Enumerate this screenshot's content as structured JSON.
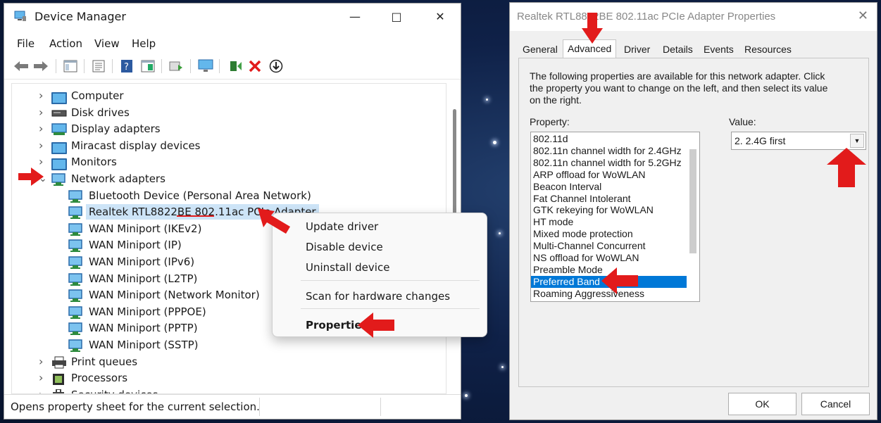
{
  "device_manager": {
    "title": "Device Manager",
    "menu": [
      "File",
      "Action",
      "View",
      "Help"
    ],
    "tree": [
      {
        "label": "Computer",
        "level": 0,
        "icon": "monitor-icon"
      },
      {
        "label": "Disk drives",
        "level": 0,
        "icon": "disk-drive-icon"
      },
      {
        "label": "Display adapters",
        "level": 0,
        "icon": "display-adapter-icon"
      },
      {
        "label": "Miracast display devices",
        "level": 0,
        "icon": "monitor-icon"
      },
      {
        "label": "Monitors",
        "level": 0,
        "icon": "monitor-icon"
      },
      {
        "label": "Network adapters",
        "level": 0,
        "icon": "network-adapter-icon",
        "expanded": true
      },
      {
        "label": "Bluetooth Device (Personal Area Network)",
        "level": 1,
        "icon": "network-adapter-icon"
      },
      {
        "label": "Realtek RTL8822BE 802.11ac PCIe Adapter",
        "level": 1,
        "icon": "network-adapter-icon",
        "selected": true
      },
      {
        "label": "WAN Miniport (IKEv2)",
        "level": 1,
        "icon": "network-adapter-icon"
      },
      {
        "label": "WAN Miniport (IP)",
        "level": 1,
        "icon": "network-adapter-icon"
      },
      {
        "label": "WAN Miniport (IPv6)",
        "level": 1,
        "icon": "network-adapter-icon"
      },
      {
        "label": "WAN Miniport (L2TP)",
        "level": 1,
        "icon": "network-adapter-icon"
      },
      {
        "label": "WAN Miniport (Network Monitor)",
        "level": 1,
        "icon": "network-adapter-icon"
      },
      {
        "label": "WAN Miniport (PPPOE)",
        "level": 1,
        "icon": "network-adapter-icon"
      },
      {
        "label": "WAN Miniport (PPTP)",
        "level": 1,
        "icon": "network-adapter-icon"
      },
      {
        "label": "WAN Miniport (SSTP)",
        "level": 1,
        "icon": "network-adapter-icon"
      },
      {
        "label": "Print queues",
        "level": 0,
        "icon": "printer-icon"
      },
      {
        "label": "Processors",
        "level": 0,
        "icon": "processor-icon"
      },
      {
        "label": "Security devices",
        "level": 0,
        "icon": "security-device-icon"
      }
    ],
    "status": "Opens property sheet for the current selection.",
    "context_menu": {
      "update_driver": "Update driver",
      "disable_device": "Disable device",
      "uninstall_device": "Uninstall device",
      "scan": "Scan for hardware changes",
      "properties": "Properties"
    }
  },
  "properties_dialog": {
    "title": "Realtek RTL8822BE 802.11ac PCIe Adapter Properties",
    "tabs": [
      "General",
      "Advanced",
      "Driver",
      "Details",
      "Events",
      "Resources"
    ],
    "active_tab": "Advanced",
    "description": "The following properties are available for this network adapter. Click the property you want to change on the left, and then select its value on the right.",
    "property_label": "Property:",
    "value_label": "Value:",
    "properties": [
      "802.11d",
      "802.11n channel width for 2.4GHz",
      "802.11n channel width for 5.2GHz",
      "ARP offload for WoWLAN",
      "Beacon Interval",
      "Fat Channel Intolerant",
      "GTK rekeying for WoWLAN",
      "HT mode",
      "Mixed mode protection",
      "Multi-Channel Concurrent",
      "NS offload for WoWLAN",
      "Preamble Mode",
      "Preferred Band",
      "Roaming Aggressiveness"
    ],
    "selected_property": "Preferred Band",
    "value": "2. 2.4G first",
    "ok_label": "OK",
    "cancel_label": "Cancel"
  },
  "colors": {
    "selection_blue": "#0078d7",
    "tree_selection": "#cde4f7",
    "arrow_red": "#e21b1b"
  }
}
